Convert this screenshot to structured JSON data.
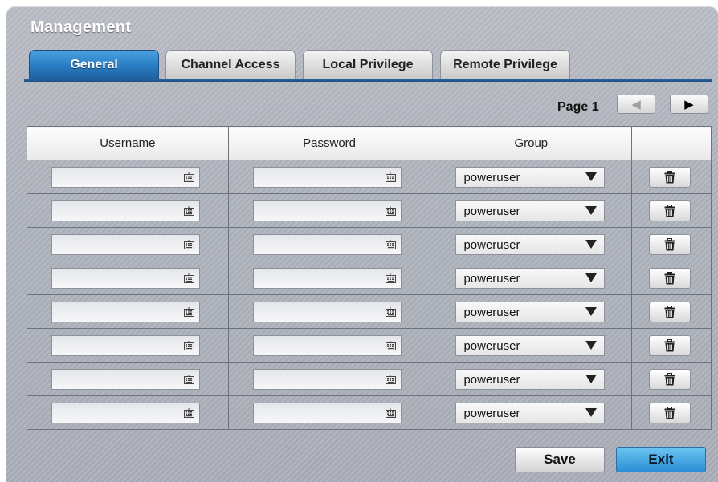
{
  "window": {
    "title": "Management"
  },
  "tabs": [
    {
      "label": "General",
      "active": true
    },
    {
      "label": "Channel Access",
      "active": false
    },
    {
      "label": "Local Privilege",
      "active": false
    },
    {
      "label": "Remote Privilege",
      "active": false
    }
  ],
  "pagination": {
    "label": "Page 1",
    "prev_icon": "arrow-left-icon",
    "next_icon": "arrow-right-icon",
    "prev_enabled": false,
    "next_enabled": true
  },
  "table": {
    "headers": [
      "Username",
      "Password",
      "Group",
      ""
    ],
    "rows": [
      {
        "username": "",
        "password": "",
        "group": "poweruser"
      },
      {
        "username": "",
        "password": "",
        "group": "poweruser"
      },
      {
        "username": "",
        "password": "",
        "group": "poweruser"
      },
      {
        "username": "",
        "password": "",
        "group": "poweruser"
      },
      {
        "username": "",
        "password": "",
        "group": "poweruser"
      },
      {
        "username": "",
        "password": "",
        "group": "poweruser"
      },
      {
        "username": "",
        "password": "",
        "group": "poweruser"
      },
      {
        "username": "",
        "password": "",
        "group": "poweruser"
      }
    ],
    "field_icon": "keyboard-icon",
    "delete_icon": "trash-icon"
  },
  "footer": {
    "save_label": "Save",
    "exit_label": "Exit"
  },
  "colors": {
    "accent": "#2c7fc6",
    "exit_button": "#4aaee6",
    "panel": "#aeb2bb"
  }
}
